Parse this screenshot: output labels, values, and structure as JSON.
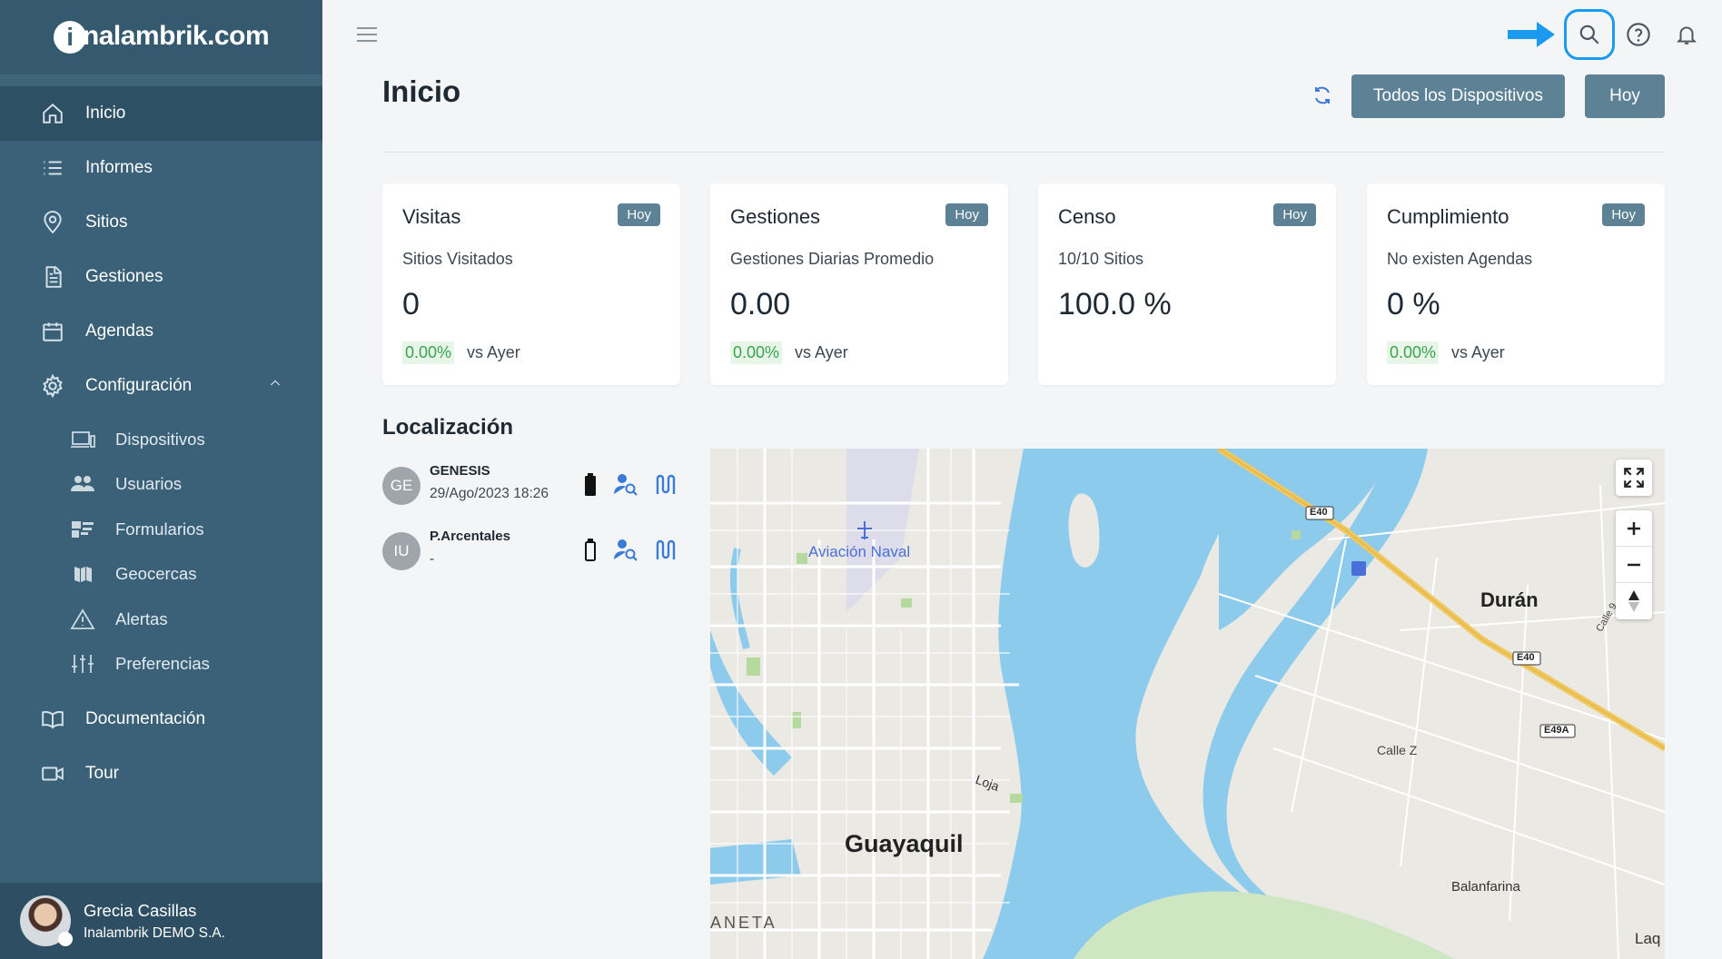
{
  "brand": {
    "logo_text": "nalambrik.com",
    "logo_letter": "i"
  },
  "sidebar": {
    "items": [
      {
        "label": "Inicio",
        "icon": "home-icon",
        "active": true
      },
      {
        "label": "Informes",
        "icon": "list-icon"
      },
      {
        "label": "Sitios",
        "icon": "location-pin-icon"
      },
      {
        "label": "Gestiones",
        "icon": "document-icon"
      },
      {
        "label": "Agendas",
        "icon": "calendar-icon"
      },
      {
        "label": "Configuración",
        "icon": "gear-icon",
        "expanded": true
      }
    ],
    "sub_items": [
      {
        "label": "Dispositivos",
        "icon": "devices-icon"
      },
      {
        "label": "Usuarios",
        "icon": "users-icon"
      },
      {
        "label": "Formularios",
        "icon": "forms-icon"
      },
      {
        "label": "Geocercas",
        "icon": "map-icon"
      },
      {
        "label": "Alertas",
        "icon": "warning-icon"
      },
      {
        "label": "Preferencias",
        "icon": "sliders-icon"
      }
    ],
    "bottom_items": [
      {
        "label": "Documentación",
        "icon": "book-icon"
      },
      {
        "label": "Tour",
        "icon": "video-icon"
      }
    ]
  },
  "user": {
    "name": "Grecia Casillas",
    "org": "Inalambrik DEMO S.A."
  },
  "header": {
    "title": "Inicio",
    "devices_button": "Todos los Dispositivos",
    "today_button": "Hoy"
  },
  "cards": [
    {
      "title": "Visitas",
      "badge": "Hoy",
      "subtitle": "Sitios Visitados",
      "value": "0",
      "pct": "0.00%",
      "cmp": "vs Ayer"
    },
    {
      "title": "Gestiones",
      "badge": "Hoy",
      "subtitle": "Gestiones Diarias Promedio",
      "value": "0.00",
      "pct": "0.00%",
      "cmp": "vs Ayer"
    },
    {
      "title": "Censo",
      "badge": "Hoy",
      "subtitle": "10/10 Sitios",
      "value": "100.0 %"
    },
    {
      "title": "Cumplimiento",
      "badge": "Hoy",
      "subtitle": "No existen Agendas",
      "value": "0 %",
      "pct": "0.00%",
      "cmp": "vs Ayer"
    }
  ],
  "location": {
    "title": "Localización",
    "devices": [
      {
        "initials": "GE",
        "name": "GENESIS",
        "time": "29/Ago/2023 18:26",
        "battery": "full"
      },
      {
        "initials": "IU",
        "name": "P.Arcentales",
        "time": "-",
        "battery": "empty"
      }
    ]
  },
  "map": {
    "labels": {
      "naval": "Aviación Naval",
      "guayaquil": "Guayaquil",
      "duran": "Durán",
      "loja": "Loja",
      "calle_z": "Calle Z",
      "balanfarina": "Balanfarina",
      "aneta": "ANETA",
      "laq": "Laq",
      "calle9": "Calle 9",
      "e40a": "E40",
      "e40b": "E40",
      "e49a": "E49A"
    },
    "colors": {
      "water": "#8dcbec",
      "land": "#ebe9e4",
      "road_major": "#f0c860",
      "park": "#b6d9a0"
    }
  }
}
